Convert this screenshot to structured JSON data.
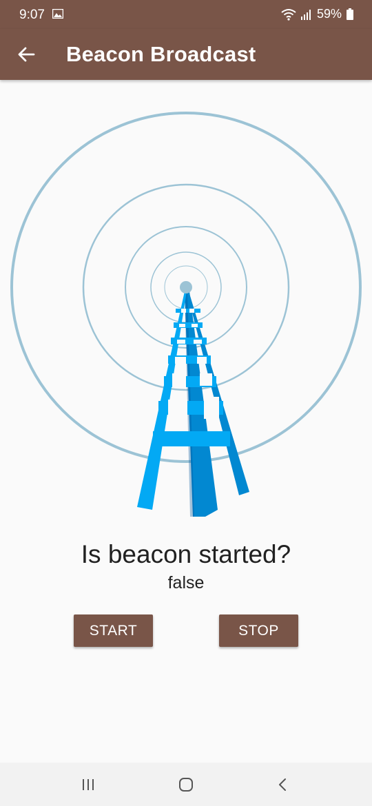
{
  "status_bar": {
    "time": "9:07",
    "battery": "59%",
    "icons": [
      "gallery-icon",
      "wifi-icon",
      "signal-icon",
      "battery-icon"
    ]
  },
  "app_bar": {
    "title": "Beacon Broadcast",
    "back_icon": "arrow-left-icon"
  },
  "main": {
    "question": "Is beacon started?",
    "status": "false",
    "start_label": "START",
    "stop_label": "STOP"
  },
  "nav_bar": {
    "items": [
      "recents-icon",
      "home-icon",
      "back-icon"
    ]
  },
  "colors": {
    "primary": "#795548",
    "ring": "#9cc3d5",
    "tower_light": "#03a9f4",
    "tower_dark": "#0288d1",
    "background": "#fafafa"
  }
}
